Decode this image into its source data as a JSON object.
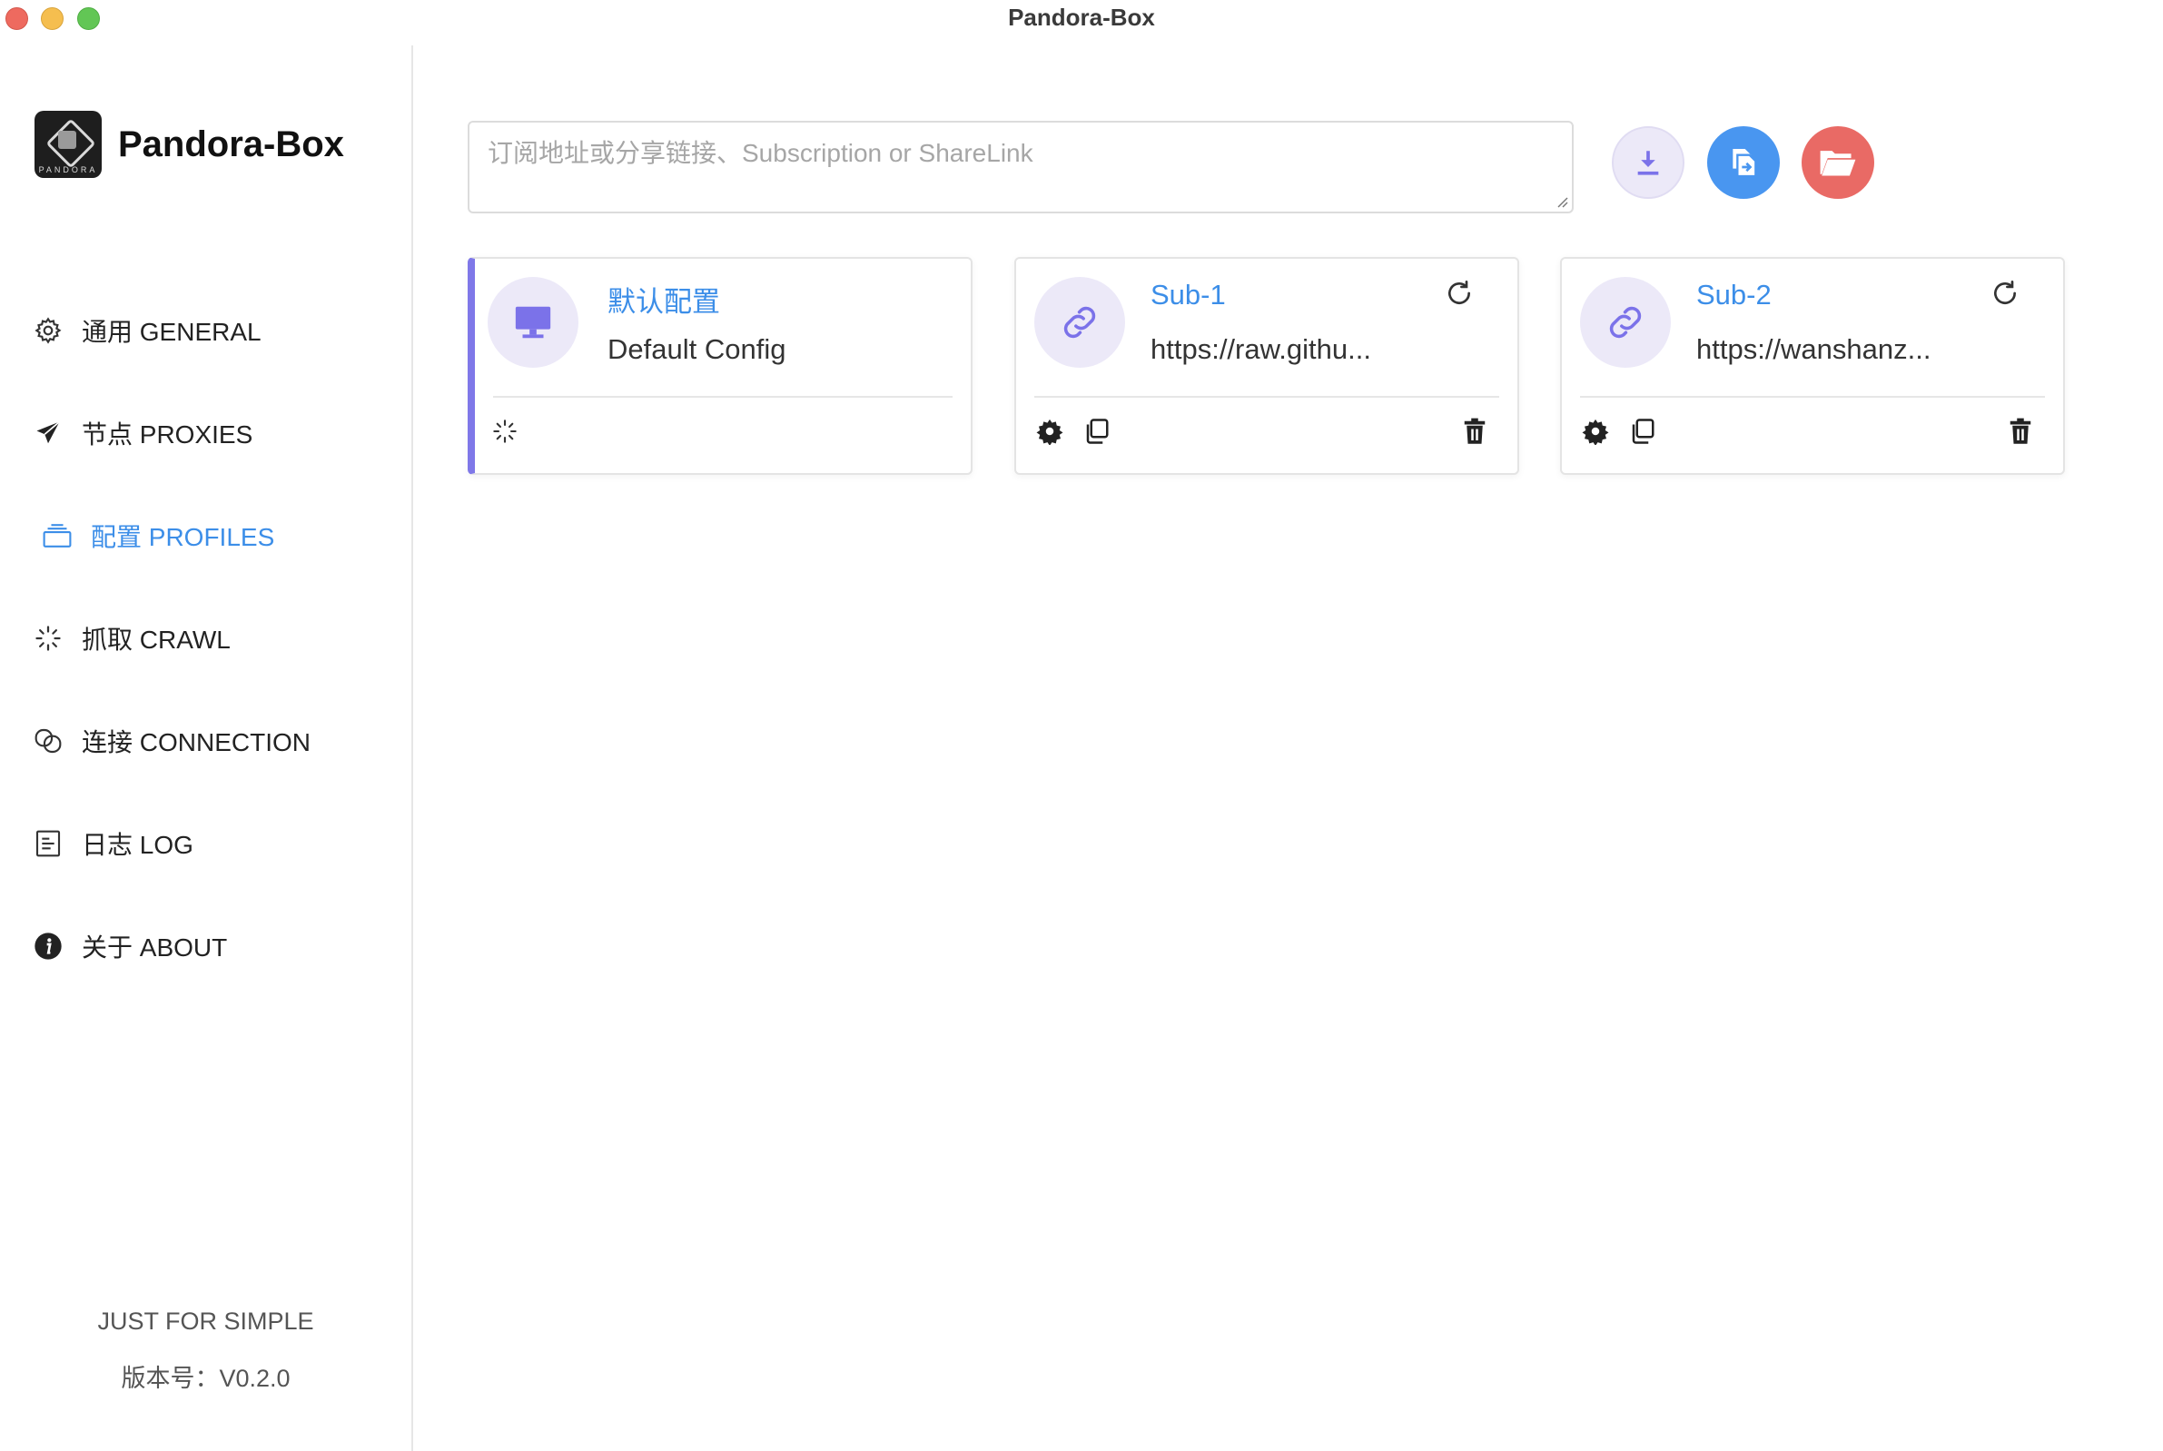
{
  "window": {
    "title": "Pandora-Box"
  },
  "app": {
    "name": "Pandora-Box",
    "logo_text": "PANDORA"
  },
  "nav": [
    {
      "icon": "gear-icon",
      "label": "通用 GENERAL",
      "active": false
    },
    {
      "icon": "paper-plane-icon",
      "label": "节点 PROXIES",
      "active": false
    },
    {
      "icon": "layers-icon",
      "label": "配置 PROFILES",
      "active": true
    },
    {
      "icon": "spinner-icon",
      "label": "抓取 CRAWL",
      "active": false
    },
    {
      "icon": "link-chain-icon",
      "label": "连接 CONNECTION",
      "active": false
    },
    {
      "icon": "document-icon",
      "label": "日志 LOG",
      "active": false
    },
    {
      "icon": "info-icon",
      "label": "关于 ABOUT",
      "active": false
    }
  ],
  "footer": {
    "slogan": "JUST FOR SIMPLE",
    "version": "版本号：V0.2.0"
  },
  "subscription_input": {
    "value": "",
    "placeholder": "订阅地址或分享链接、Subscription or ShareLink"
  },
  "actions": [
    {
      "name": "download",
      "icon": "download-icon",
      "color": "#ece9f8"
    },
    {
      "name": "copy",
      "icon": "copy-file-icon",
      "color": "#4996f0"
    },
    {
      "name": "folder",
      "icon": "folder-open-icon",
      "color": "#e96a65"
    }
  ],
  "profiles": [
    {
      "name": "默认配置",
      "subtitle": "Default Config",
      "icon": "monitor-icon",
      "active": true
    },
    {
      "name": "Sub-1",
      "subtitle": "https://raw.githu...",
      "icon": "link-icon",
      "active": false
    },
    {
      "name": "Sub-2",
      "subtitle": "https://wanshanz...",
      "icon": "link-icon",
      "active": false
    }
  ],
  "colors": {
    "accent": "#3c8ee8",
    "active_bar": "#7f78e8",
    "icon_purple": "#7b72e9"
  }
}
